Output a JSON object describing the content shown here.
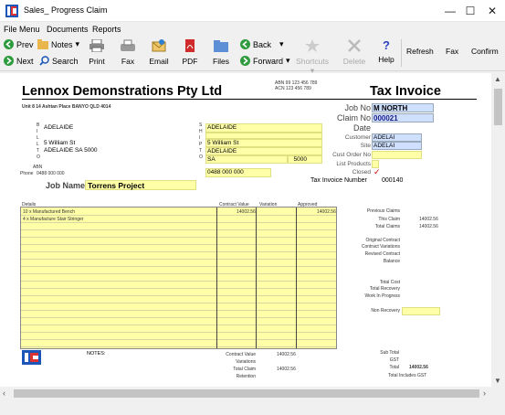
{
  "window": {
    "title": "Sales_ Progress Claim",
    "minimize": "—",
    "maximize": "☐",
    "close": "✕"
  },
  "menu": [
    "File Menu",
    "Documents",
    "Reports"
  ],
  "toolbar": {
    "prev": "Prev",
    "next": "Next",
    "notes": "Notes",
    "search": "Search",
    "print": "Print",
    "fax": "Fax",
    "email": "Email",
    "pdf": "PDF",
    "files": "Files",
    "back": "Back",
    "forward": "Forward",
    "shortcuts": "Shortcuts",
    "delete": "Delete",
    "help": "Help",
    "refresh": "Refresh",
    "fax2": "Fax",
    "confirm": "Confirm",
    "dropdown": "▾"
  },
  "doc": {
    "company": "Lennox Demonstrations Pty Ltd",
    "abn": "ABN 99 123 456 789",
    "acn": "ACN 123 456 789",
    "doc_title": "Tax Invoice",
    "company_address": "Unit 8 14 Ashtan Place BANYO QLD 4014",
    "bill_label": "BILL TO",
    "ship_label": "SHIP TO",
    "bill_name": "ADELAIDE",
    "bill_addr1": "5 William St",
    "bill_addr2": "ADELAIDE SA 5000",
    "abn_label": "ABN",
    "phone_label": "Phone",
    "phone_left": "0488 000 000",
    "ship_name": "ADELAIDE",
    "ship_addr1": "5 William St",
    "ship_city": "ADELAIDE",
    "ship_state": "SA",
    "ship_post": "5000",
    "ship_phone": "0488 000 000",
    "job_no_label": "Job No",
    "job_no": "M NORTH",
    "claim_no_label": "Claim No",
    "claim_no": "000021",
    "date_label": "Date",
    "date": "",
    "customer_label": "Customer",
    "customer": "ADELAI",
    "site_label": "Site",
    "site": "ADELAI",
    "cust_order_label": "Cust Order No",
    "list_products_label": "List Products",
    "closed_label": "Closed",
    "closed_mark": "✓",
    "tax_invoice_number_label": "Tax Invoice Number",
    "tax_invoice_number": "000140",
    "job_name_label": "Job Name",
    "job_name": "Torrens Project"
  },
  "table": {
    "headers": [
      "Details",
      "Contract Value",
      "Variation",
      "Approved"
    ],
    "rows": [
      {
        "details": "10 x Manufactured Bench",
        "contract": "14002.56",
        "variation": "",
        "approved": "14002.56"
      },
      {
        "details": "4 x Manufacture Stair Stringer",
        "contract": "",
        "variation": "",
        "approved": ""
      }
    ]
  },
  "summary": {
    "previous_claims": "Previous Claims",
    "this_claim": "This Claim",
    "this_claim_value": "14002.56",
    "total_claims": "Total Claims",
    "total_claims_value": "14002.56",
    "original_contract": "Original Contract",
    "contract_variations": "Contract Variations",
    "revised_contract": "Revised Contract",
    "balance": "Balance",
    "total_cost": "Total Cost",
    "total_recovery": "Total Recovery",
    "work_in_progress": "Work In Progress",
    "non_recovery": "Non Recovery"
  },
  "footer": {
    "notes_label": "NOTES:",
    "contract_value_label": "Contract Value",
    "contract_value": "14002.56",
    "variations_label": "Variations",
    "total_claim_label": "Total Claim",
    "total_claim": "14002.56",
    "retention_label": "Retention",
    "sub_total_label": "Sub Total",
    "gst_label": "GST",
    "total_label": "Total",
    "total_value": "14002.56",
    "total_includes_gst": "Total Includes GST"
  }
}
